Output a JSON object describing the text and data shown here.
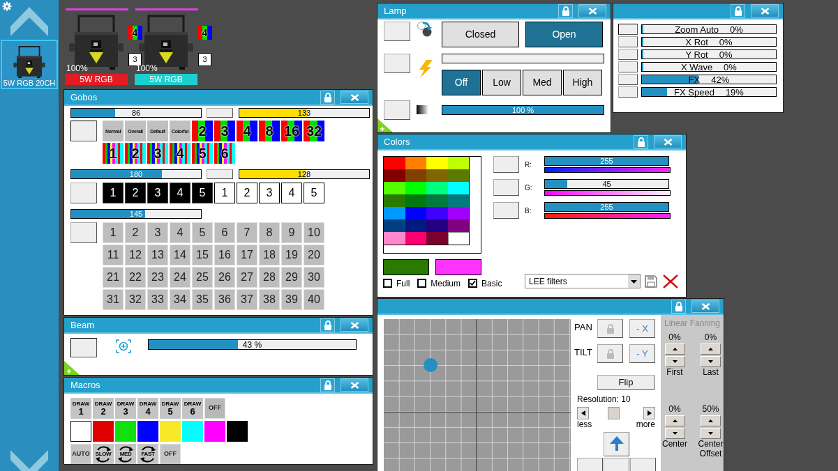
{
  "sidebar": {
    "fixture": {
      "label": "5W RGB 20CH",
      "selected": true
    }
  },
  "fixtures": [
    {
      "selected": true,
      "gobo_badge": "4",
      "group_badge": "3",
      "intensity": "100%",
      "name": "5W RGB",
      "color": "#e31b23"
    },
    {
      "selected": true,
      "gobo_badge": "4",
      "group_badge": "3",
      "intensity": "100%",
      "name": "5W RGB",
      "color": "#1ccfcf"
    }
  ],
  "gobos": {
    "title": "Gobos",
    "wheel": {
      "slider": {
        "value": "86",
        "level": 0.34
      },
      "rotation": {
        "value": "133",
        "level": 0.52
      },
      "rows": [
        [
          {
            "kind": "label",
            "label": "Normal"
          },
          {
            "kind": "label",
            "label": "Overall"
          },
          {
            "kind": "label",
            "label": "Default"
          },
          {
            "kind": "label",
            "label": "Colorful"
          },
          {
            "kind": "stripes",
            "label": "2"
          },
          {
            "kind": "stripes",
            "label": "3"
          },
          {
            "kind": "stripes",
            "label": "4"
          },
          {
            "kind": "stripes",
            "label": "8"
          },
          {
            "kind": "stripes",
            "label": "16"
          },
          {
            "kind": "stripes",
            "label": "32"
          }
        ],
        [
          {
            "kind": "rainbow",
            "label": "1"
          },
          {
            "kind": "rainbow",
            "label": "2"
          },
          {
            "kind": "rainbow",
            "label": "3"
          },
          {
            "kind": "rainbow",
            "label": "4"
          },
          {
            "kind": "rainbow",
            "label": "5"
          },
          {
            "kind": "rainbow",
            "label": "6"
          }
        ]
      ]
    },
    "prism": {
      "slider": {
        "value": "180",
        "level": 0.7
      },
      "rotation": {
        "value": "128",
        "level": 0.51
      },
      "rows": [
        [
          {
            "kind": "dark",
            "label": "1"
          },
          {
            "kind": "dark",
            "label": "2"
          },
          {
            "kind": "dark",
            "label": "3"
          },
          {
            "kind": "dark",
            "label": "4"
          },
          {
            "kind": "dark",
            "label": "5"
          },
          {
            "kind": "light",
            "label": "1"
          },
          {
            "kind": "light",
            "label": "2"
          },
          {
            "kind": "light",
            "label": "3"
          },
          {
            "kind": "light",
            "label": "4"
          },
          {
            "kind": "light",
            "label": "5"
          }
        ]
      ]
    },
    "pattern": {
      "slider": {
        "value": "145",
        "level": 0.57
      },
      "rows": [
        [
          {
            "kind": "plain",
            "label": "1"
          },
          {
            "kind": "plain",
            "label": "2"
          },
          {
            "kind": "plain",
            "label": "3"
          },
          {
            "kind": "plain",
            "label": "4"
          },
          {
            "kind": "plain",
            "label": "5"
          },
          {
            "kind": "plain",
            "label": "6"
          },
          {
            "kind": "plain",
            "label": "7"
          },
          {
            "kind": "plain",
            "label": "8"
          },
          {
            "kind": "plain",
            "label": "9"
          },
          {
            "kind": "plain",
            "label": "10"
          }
        ],
        [
          {
            "kind": "plain",
            "label": "11"
          },
          {
            "kind": "plain",
            "label": "12"
          },
          {
            "kind": "plain",
            "label": "13"
          },
          {
            "kind": "plain",
            "label": "14"
          },
          {
            "kind": "plain",
            "label": "15"
          },
          {
            "kind": "plain",
            "label": "16"
          },
          {
            "kind": "plain",
            "label": "17"
          },
          {
            "kind": "plain",
            "label": "18"
          },
          {
            "kind": "plain",
            "label": "19"
          },
          {
            "kind": "plain",
            "label": "20"
          }
        ],
        [
          {
            "kind": "plain",
            "label": "21"
          },
          {
            "kind": "plain",
            "label": "22"
          },
          {
            "kind": "plain",
            "label": "23"
          },
          {
            "kind": "plain",
            "label": "24"
          },
          {
            "kind": "plain",
            "label": "25"
          },
          {
            "kind": "plain",
            "label": "26"
          },
          {
            "kind": "plain",
            "label": "27"
          },
          {
            "kind": "plain",
            "label": "28"
          },
          {
            "kind": "plain",
            "label": "29"
          },
          {
            "kind": "plain",
            "label": "30"
          }
        ],
        [
          {
            "kind": "plain",
            "label": "31"
          },
          {
            "kind": "plain",
            "label": "32"
          },
          {
            "kind": "plain",
            "label": "33"
          },
          {
            "kind": "plain",
            "label": "34"
          },
          {
            "kind": "plain",
            "label": "35"
          },
          {
            "kind": "plain",
            "label": "36"
          },
          {
            "kind": "plain",
            "label": "37"
          },
          {
            "kind": "plain",
            "label": "38"
          },
          {
            "kind": "plain",
            "label": "39"
          },
          {
            "kind": "plain",
            "label": "40"
          }
        ]
      ]
    }
  },
  "beam": {
    "title": "Beam",
    "zoom": {
      "value": "43 %",
      "level": 0.43
    }
  },
  "macros": {
    "title": "Macros",
    "patterns": [
      {
        "kind": "draw",
        "line1": "DRAW",
        "line2": "1"
      },
      {
        "kind": "draw",
        "line1": "DRAW",
        "line2": "2"
      },
      {
        "kind": "draw",
        "line1": "DRAW",
        "line2": "3"
      },
      {
        "kind": "draw",
        "line1": "DRAW",
        "line2": "4"
      },
      {
        "kind": "draw",
        "line1": "DRAW",
        "line2": "5"
      },
      {
        "kind": "draw",
        "line1": "DRAW",
        "line2": "6"
      },
      {
        "kind": "text",
        "label": "OFF"
      }
    ],
    "colors": [
      {
        "color": "#ffffff"
      },
      {
        "color": "#e00000"
      },
      {
        "color": "#10e010"
      },
      {
        "color": "#0000ff"
      },
      {
        "color": "#f8e82a"
      },
      {
        "color": "#00ffff"
      },
      {
        "color": "#ff00ff"
      },
      {
        "color": "#000000"
      }
    ],
    "speeds": [
      {
        "kind": "text",
        "label": "AUTO"
      },
      {
        "kind": "cycle",
        "label": "SLOW"
      },
      {
        "kind": "cycle",
        "label": "MED"
      },
      {
        "kind": "cycle",
        "label": "FAST"
      },
      {
        "kind": "text",
        "label": "OFF"
      }
    ]
  },
  "lamp": {
    "title": "Lamp",
    "shutter": [
      {
        "label": "Closed",
        "selected": false
      },
      {
        "label": "Open",
        "selected": true
      }
    ],
    "strobe": {
      "level": 0
    },
    "strobe_modes": [
      {
        "label": "Off",
        "selected": true
      },
      {
        "label": "Low",
        "selected": false
      },
      {
        "label": "Med",
        "selected": false
      },
      {
        "label": "High",
        "selected": false
      }
    ],
    "dimmer": {
      "value": "100 %",
      "level": 1
    }
  },
  "effects": [
    {
      "label": "Zoom Auto",
      "value": "0%",
      "level": 0
    },
    {
      "label": "X Rot",
      "value": "0%",
      "level": 0
    },
    {
      "label": "Y Rot",
      "value": "0%",
      "level": 0
    },
    {
      "label": "X Wave",
      "value": "0%",
      "level": 0
    },
    {
      "label": "FX",
      "value": "42%",
      "level": 0.42
    },
    {
      "label": "FX Speed",
      "value": "19%",
      "level": 0.19
    }
  ],
  "colors": {
    "title": "Colors",
    "palette": [
      {
        "color": "#ff0000"
      },
      {
        "color": "#ff8000"
      },
      {
        "color": "#ffff00"
      },
      {
        "color": "#bfff00"
      },
      {
        "color": "#800000"
      },
      {
        "color": "#804000"
      },
      {
        "color": "#806600"
      },
      {
        "color": "#5c7a00"
      },
      {
        "color": "#55ff00"
      },
      {
        "color": "#00ff00"
      },
      {
        "color": "#00ff80"
      },
      {
        "color": "#00ffff"
      },
      {
        "color": "#2a7a00"
      },
      {
        "color": "#007a10"
      },
      {
        "color": "#007a40"
      },
      {
        "color": "#007a7a"
      },
      {
        "color": "#0099ff"
      },
      {
        "color": "#0000ff"
      },
      {
        "color": "#4000ff"
      },
      {
        "color": "#a000ff"
      },
      {
        "color": "#004080"
      },
      {
        "color": "#001a80"
      },
      {
        "color": "#200080"
      },
      {
        "color": "#800080"
      },
      {
        "color": "#ff88cc"
      },
      {
        "color": "#ff0070"
      },
      {
        "color": "#7a0030"
      },
      {
        "color": "#ffffff"
      }
    ],
    "channels": [
      {
        "label": "R:",
        "value": "255",
        "level": 1
      },
      {
        "label": "G:",
        "value": "45",
        "level": 0.18
      },
      {
        "label": "B:",
        "value": "255",
        "level": 1
      }
    ],
    "swatches": [
      {
        "color": "#2a7a00"
      },
      {
        "color": "#ff33ff"
      }
    ],
    "modes": [
      {
        "label": "Full",
        "checked": false
      },
      {
        "label": "Medium",
        "checked": false
      },
      {
        "label": "Basic",
        "checked": true
      }
    ],
    "filter_select": {
      "value": "LEE filters"
    }
  },
  "pan_tilt": {
    "axes": [
      {
        "label": "PAN",
        "invert": "- X"
      },
      {
        "label": "TILT",
        "invert": "- Y"
      }
    ],
    "flip": "Flip",
    "resolution": {
      "label": "Resolution: 10",
      "level": 0.45,
      "less": "less",
      "more": "more"
    },
    "fanning": {
      "title": "Linear Fanning",
      "controls": [
        {
          "value": "0%",
          "label": "First"
        },
        {
          "value": "0%",
          "label": "Last"
        },
        {
          "value": "0%",
          "label": "Center"
        },
        {
          "value": "50%",
          "label": "Center Offset"
        }
      ]
    }
  }
}
